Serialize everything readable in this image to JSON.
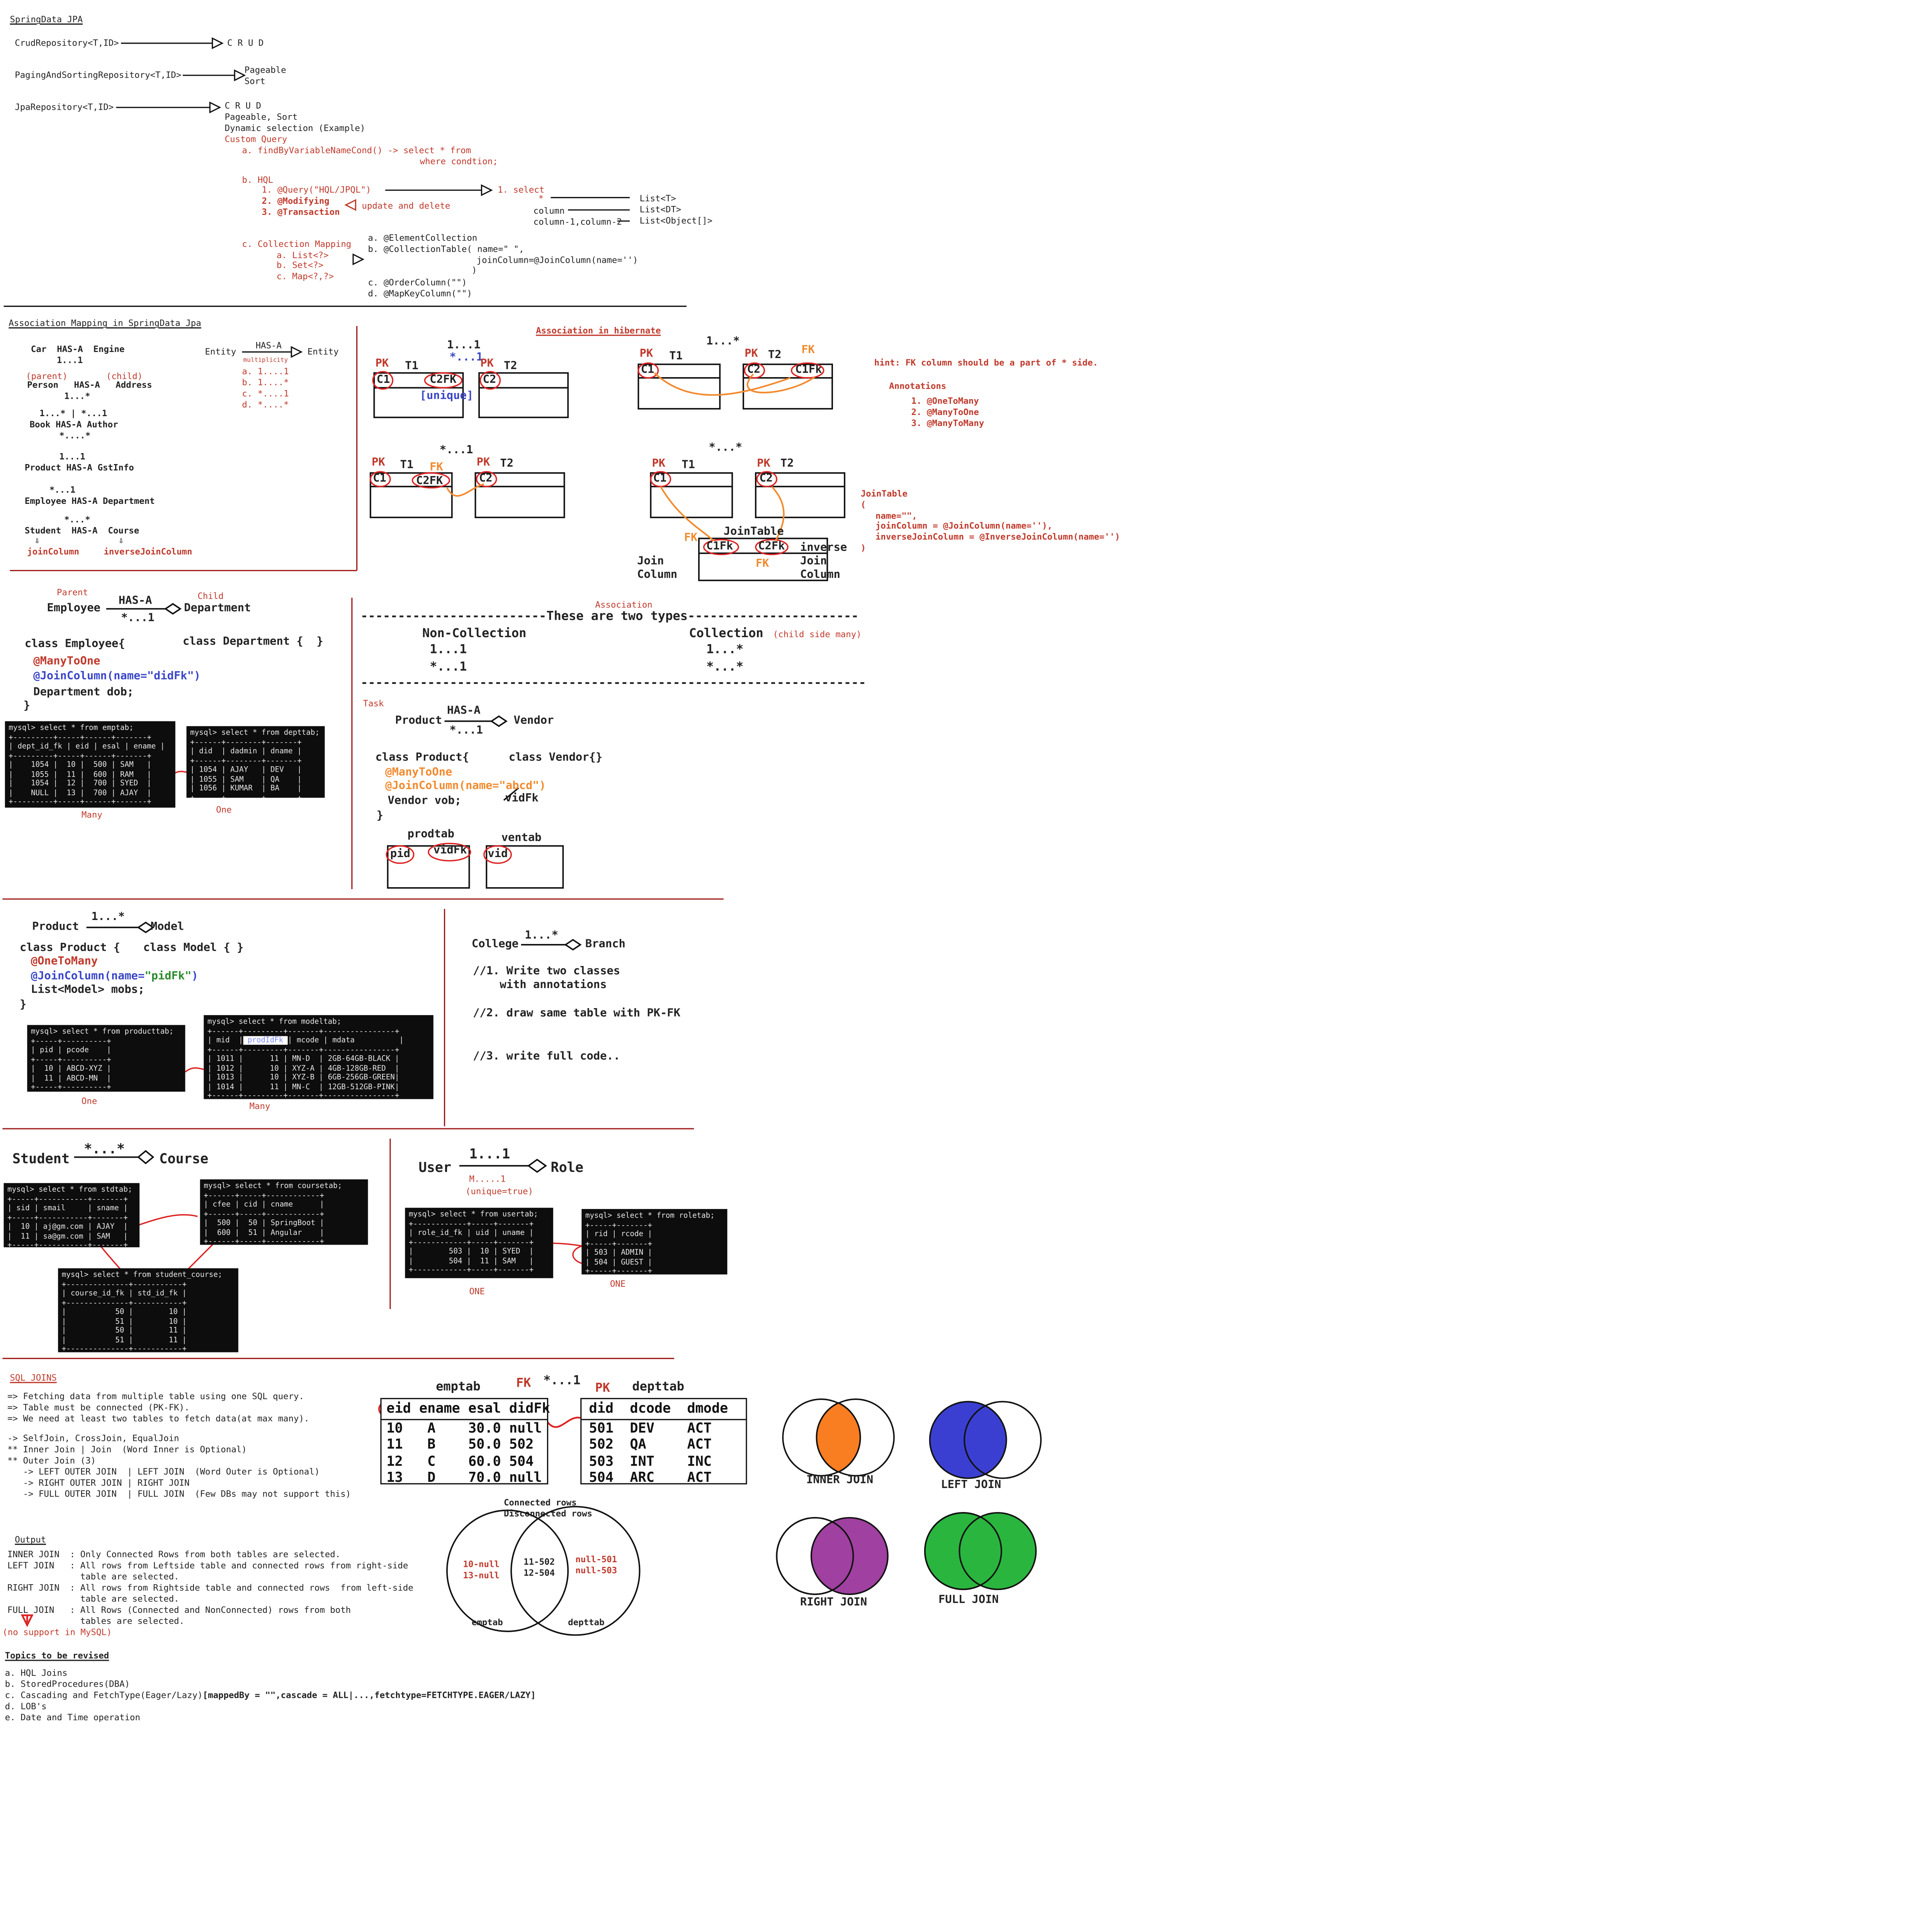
{
  "s1": {
    "title": "SpringData JPA",
    "crud_repo": "CrudRepository<T,ID>",
    "crud_txt": "C R U D",
    "paging_repo": "PagingAndSortingRepository<T,ID>",
    "pageable": "Pageable",
    "sort": "Sort",
    "jpa_repo": "JpaRepository<T,ID>",
    "jpa_crud": "C R U D",
    "jpa_ps": "Pageable, Sort",
    "jpa_dyn": "Dynamic selection (Example)",
    "custom_query": "Custom Query",
    "find_a": "a. findByVariableNameCond() -> select * from",
    "find_b": "where condtion;",
    "hql": "b. HQL",
    "hql_1": "1. @Query(\"HQL/JPQL\")",
    "hql_2": "2. @Modifying",
    "hql_3": "3. @Transaction",
    "upd_del": "update and delete",
    "select_1": "1. select",
    "star": "*",
    "column": "column",
    "col12": "column-1,column-2",
    "list_t": "List<T>",
    "list_dt": "List<DT>",
    "list_obj": "List<Object[]>",
    "coll_map": "c. Collection Mapping",
    "list_q": "a. List<?>",
    "set_q": "b. Set<?>",
    "map_q": "c. Map<?,?>",
    "ec_a": "a. @ElementCollection",
    "ec_b": "b. @CollectionTable( name=\" \",",
    "ec_jc": "joinColumn=@JoinColumn(name='')",
    "ec_close": ")",
    "ec_c": "c. @OrderColumn(\"\")",
    "ec_d": "d. @MapKeyColumn(\"\")"
  },
  "s2": {
    "title": "Association Mapping in SpringData Jpa",
    "car": "Car  HAS-A  Engine",
    "car_m": "1...1",
    "parent": "(parent)",
    "child": "(child)",
    "person": "Person   HAS-A   Address",
    "person_m": "1...*",
    "book_m1": "1...* | *...1",
    "book": "Book HAS-A Author",
    "book_m2": "*....*",
    "product_m": "1...1",
    "product": "Product HAS-A GstInfo",
    "emp_m": "*...1",
    "emp": "Employee HAS-A Department",
    "student_m": "*...*",
    "student": "Student  HAS-A  Course",
    "join_col": "joinColumn",
    "inv_join_col": "inverseJoinColumn",
    "entity1": "Entity",
    "hasa": "HAS-A",
    "entity2": "Entity",
    "multiplicity": "multiplicity",
    "m_a": "a. 1....1",
    "m_b": "b. 1....*",
    "m_c": "c. *....1",
    "m_d": "d. *....*"
  },
  "s3": {
    "one_one": "1...1",
    "star_one_blue": "*...1",
    "unique": "[unique]",
    "pk": "PK",
    "fk": "FK",
    "t1": "T1",
    "t2": "T2",
    "c1": "C1",
    "c2": "C2",
    "c2fk": "C2FK",
    "c1fk": "C1Fk",
    "c2fk2": "C2Fk",
    "assoc_hib": "Association in hibernate",
    "one_many": "1...*",
    "many_one": "*...1",
    "many_many": "*...*",
    "hint": "hint: FK column should be a part of * side.",
    "annotations": "Annotations",
    "ann_1": "1. @OneToMany",
    "ann_2": "2. @ManyToOne",
    "ann_3": "3. @ManyToMany",
    "jointable_title": "JoinTable",
    "jt_open": "(",
    "jt_name": "name=\"\",",
    "jt_jc": "joinColumn = @JoinColumn(name=''),",
    "jt_ijc": "inverseJoinColumn = @InverseJoinColumn(name='')",
    "jt_close": ")",
    "jointable": "JoinTable",
    "join_column": "Join\nColumn",
    "inverse_join_column": "inverse\nJoin\nColumn"
  },
  "s4": {
    "parent": "Parent",
    "child": "Child",
    "employee": "Employee",
    "hasa": "HAS-A",
    "department": "Department",
    "mult": "*...1",
    "class_emp": "class Employee{",
    "class_dept": "class Department {  }",
    "mto": "@ManyToOne",
    "jc": "@JoinColumn(name=\"didFk\")",
    "dob": "Department dob;",
    "close": "}",
    "term_emp": "mysql> select * from emptab;\n+---------+-----+------+-------+\n| dept_id_fk | eid | esal | ename |\n+---------+-----+------+-------+\n|    1054 |  10 |  500 | SAM   |\n|    1055 |  11 |  600 | RAM   |\n|    1054 |  12 |  700 | SYED  |\n|    NULL |  13 |  700 | AJAY  |\n+---------+-----+------+-------+",
    "term_dept": "mysql> select * from depttab;\n+------+--------+-------+\n| did  | dadmin | dname |\n+------+--------+-------+\n| 1054 | AJAY   | DEV   |\n| 1055 | SAM    | QA    |\n| 1056 | KUMAR  | BA    |\n+------+--------+-------+",
    "many": "Many",
    "one": "One"
  },
  "s5": {
    "association": "Association",
    "types_line": "-------------------------These are two types-----------------------",
    "non_collection": "Non-Collection",
    "collection": "Collection",
    "child_side": "(child side many)",
    "nc_1": "1...1",
    "nc_2": "*...1",
    "c_1": "1...*",
    "c_2": "*...*",
    "dash_line": "--------------------------------------------------------------------",
    "task": "Task",
    "product": "Product",
    "hasa": "HAS-A",
    "vendor": "Vendor",
    "mult": "*...1",
    "class_product": "class Product{",
    "class_vendor": "class Vendor{}",
    "mto": "@ManyToOne",
    "jc": "@JoinColumn(name=\"abcd\")",
    "vendor_vob": "Vendor vob;",
    "vidfk_note": "vidFk",
    "close": "}",
    "prodtab": "prodtab",
    "ventab": "ventab",
    "pid": "pid",
    "vidfk": "vidFk",
    "vid": "vid"
  },
  "s6": {
    "product": "Product",
    "mult": "1...*",
    "model": "Model",
    "class_product": "class Product {",
    "class_model": "class Model { }",
    "otm": "@OneToMany",
    "jc_pre": "@JoinColumn(name=",
    "jc_val": "\"pidFk\"",
    "jc_post": ")",
    "list": "List<Model> mobs;",
    "close": "}",
    "term_prod": "mysql> select * from producttab;\n+-----+----------+\n| pid | pcode    |\n+-----+----------+\n|  10 | ABCD-XYZ |\n|  11 | ABCD-MN  |\n+-----+----------+",
    "term_model_head": "mysql> select * from modeltab;\n+------+---------+-------+----------------+\n| mid  |",
    "term_model_hl": " prodIdFk ",
    "term_model_rest": "| mcode | mdata          |\n+------+---------+-------+----------------+\n| 1011 |      11 | MN-D  | 2GB-64GB-BLACK |\n| 1012 |      10 | XYZ-A | 4GB-128GB-RED  |\n| 1013 |      10 | XYZ-B | 6GB-256GB-GREEN|\n| 1014 |      11 | MN-C  | 12GB-512GB-PINK|\n+------+---------+-------+----------------+",
    "one": "One",
    "many": "Many"
  },
  "s7": {
    "college": "College",
    "mult": "1...*",
    "branch": "Branch",
    "q1": "//1. Write two classes\n    with annotations",
    "q2": "//2. draw same table with PK-FK",
    "q3": "//3. write full code.."
  },
  "s8": {
    "student": "Student",
    "mult": "*...*",
    "course": "Course",
    "term_std": "mysql> select * from stdtab;\n+-----+-----------+-------+\n| sid | smail     | sname |\n+-----+-----------+-------+\n|  10 | aj@gm.com | AJAY  |\n|  11 | sa@gm.com | SAM   |\n+-----+-----------+-------+",
    "term_course": "mysql> select * from coursetab;\n+------+-----+------------+\n| cfee | cid | cname      |\n+------+-----+------------+\n|  500 |  50 | SpringBoot |\n|  600 |  51 | Angular    |\n+------+-----+------------+",
    "term_sc": "mysql> select * from student_course;\n+--------------+-----------+\n| course_id_fk | std_id_fk |\n+--------------+-----------+\n|           50 |        10 |\n|           51 |        10 |\n|           50 |        11 |\n|           51 |        11 |\n+--------------+-----------+"
  },
  "s9": {
    "user": "User",
    "mult": "1...1",
    "role": "Role",
    "m1": "M.....1",
    "unique": "(unique=true)",
    "term_user": "mysql> select * from usertab;\n+------------+-----+-------+\n| role_id_fk | uid | uname |\n+------------+-----+-------+\n|        503 |  10 | SYED  |\n|        504 |  11 | SAM   |\n+------------+-----+-------+",
    "term_role": "mysql> select * from roletab;\n+-----+-------+\n| rid | rcode |\n+-----+-------+\n| 503 | ADMIN |\n| 504 | GUEST |\n+-----+-------+",
    "one_a": "ONE",
    "one_b": "ONE"
  },
  "s10": {
    "title": "SQL JOINS",
    "l1": "=> Fetching data from multiple table using one SQL query.",
    "l2": "=> Table must be connected (PK-FK).",
    "l3": "=> We need at least two tables to fetch data(at max many).",
    "l4": "-> SelfJoin, CrossJoin, EqualJoin",
    "l5": "** Inner Join | Join  (Word Inner is Optional)",
    "l6": "** Outer Join (3)",
    "l7": "   -> LEFT OUTER JOIN  | LEFT JOIN  (Word Outer is Optional)",
    "l8": "   -> RIGHT OUTER JOIN | RIGHT JOIN",
    "l9": "   -> FULL OUTER JOIN  | FULL JOIN  (Few DBs may not support this)",
    "output": "Output",
    "o1": "INNER JOIN  : Only Connected Rows from both tables are selected.",
    "o2": "LEFT JOIN   : All rows from Leftside table and connected rows from right-side\n              table are selected.",
    "o3": "RIGHT JOIN  : All rows from Rightside table and connected rows  from left-side\n              table are selected.",
    "o4": "FULL JOIN   : All Rows (Connected and NonConnected) rows from both\n              tables are selected.",
    "no_support": "(no support in MySQL)",
    "topics": "Topics to be revised",
    "ta": "a. HQL Joins",
    "tb": "b. StoredProcedures(DBA)",
    "tc_pre": "c. Cascading and FetchType(Eager/Lazy)",
    "tc_bold": "[mappedBy = \"\",cascade = ALL|...,fetchtype=FETCHTYPE.EAGER/LAZY]",
    "td": "d. LOB's",
    "te": "e. Date and Time operation",
    "fk": "FK",
    "mult": "*...1",
    "pk": "PK",
    "emptab": "emptab",
    "depttab": "depttab",
    "emp_head": "eid ename esal didFk",
    "emp_rows": "10   A    30.0 null\n11   B    50.0 502\n12   C    60.0 504\n13   D    70.0 null",
    "dept_head": "did  dcode  dmode",
    "dept_rows": "501  DEV    ACT\n502  QA     ACT\n503  INT    INC\n504  ARC    ACT",
    "connected": "Connected rows\nDisconnected rows",
    "v_left": "10-null\n13-null",
    "v_mid": "11-502\n12-504",
    "v_right": "null-501\nnull-503",
    "v_emptab": "emptab",
    "v_depttab": "depttab",
    "inner_join": "INNER JOIN",
    "left_join": "LEFT JOIN",
    "right_join": "RIGHT JOIN",
    "full_join": "FULL JOIN"
  },
  "colors": {
    "accent_red": "#c0392b",
    "blue": "#3a46c8",
    "orange": "#f28a2e",
    "inner": "#f97d21",
    "left": "#3b3fd1",
    "right": "#a040a0",
    "full": "#2ab53f"
  }
}
